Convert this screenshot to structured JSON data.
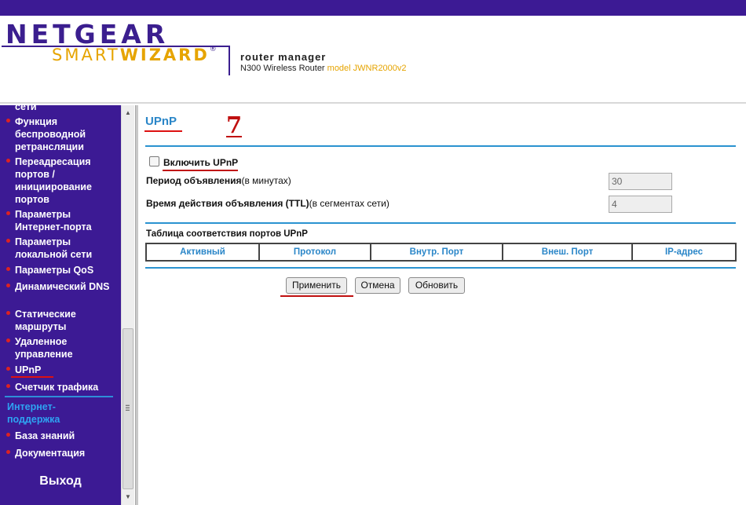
{
  "header": {
    "brand": "NETGEAR",
    "product_prefix": "SMART",
    "product_bold": "WIZARD",
    "product_mark": "®",
    "title": "router manager",
    "subtitle": "N300 Wireless Router",
    "model": "model JWNR2000v2"
  },
  "sidebar": {
    "items": [
      {
        "label": "сети",
        "bullet": false
      },
      {
        "label": "Функция беспроводной ретрансляции",
        "bullet": true
      },
      {
        "label": "Переадресация портов / инициирование портов",
        "bullet": true
      },
      {
        "label": "Параметры Интернет-порта",
        "bullet": true
      },
      {
        "label": "Параметры локальной сети",
        "bullet": true
      },
      {
        "label": "Параметры QoS",
        "bullet": true
      },
      {
        "label": "Динамический DNS",
        "bullet": true
      },
      {
        "label": "Статические маршруты",
        "bullet": true
      },
      {
        "label": "Удаленное управление",
        "bullet": true
      },
      {
        "label": "UPnP",
        "bullet": true,
        "active": true
      },
      {
        "label": "Счетчик трафика",
        "bullet": true
      }
    ],
    "support_heading": "Интернет-поддержка",
    "support_items": [
      {
        "label": "База знаний"
      },
      {
        "label": "Документация"
      }
    ],
    "logout": "Выход"
  },
  "main": {
    "title": "UPnP",
    "step_number": "7",
    "enable_upnp": {
      "label": "Включить UPnP",
      "checked": false
    },
    "adv_period": {
      "label_bold": "Период объявления",
      "label_unit": "(в минутах)",
      "value": "30"
    },
    "adv_ttl": {
      "label_bold": "Время действия объявления (TTL)",
      "label_unit": "(в сегментах сети)",
      "value": "4"
    },
    "table": {
      "caption": "Таблица соответствия портов UPnP",
      "columns": [
        "Активный",
        "Протокол",
        "Внутр. Порт",
        "Внеш. Порт",
        "IP-адрес"
      ],
      "rows": []
    },
    "buttons": {
      "apply": "Применить",
      "cancel": "Отмена",
      "refresh": "Обновить"
    }
  },
  "colors": {
    "brand_purple": "#3c1a94",
    "accent_blue": "#2a86c8",
    "annotation_red": "#c01010",
    "logo_gold": "#e6a400"
  }
}
